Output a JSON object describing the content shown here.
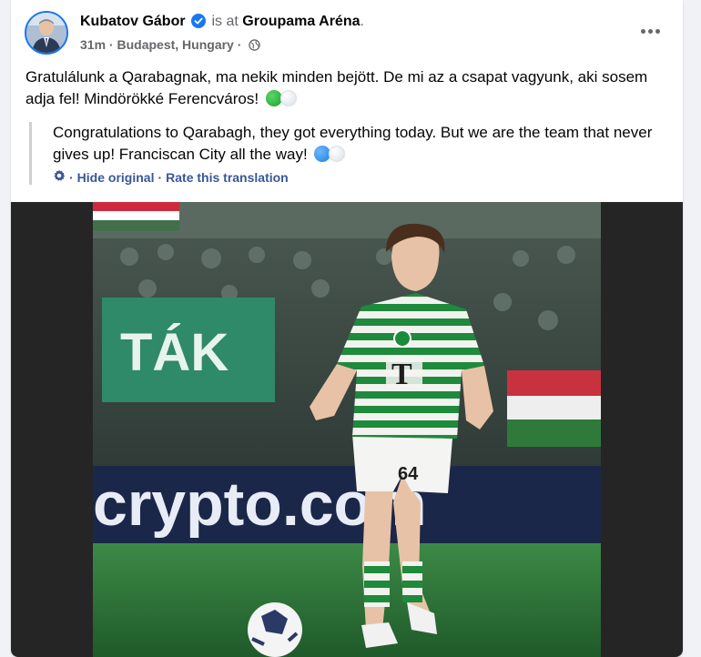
{
  "post": {
    "author_name": "Kubatov Gábor",
    "is_at": "is at",
    "place": "Groupama Aréna",
    "period": ".",
    "time": "31m",
    "location": "Budapest, Hungary",
    "separator": "·",
    "original_text": "Gratulálunk a Qarabagnak, ma nekik minden bejött. De mi az a csapat vagyunk, aki sosem adja fel! Mindörökké Ferencváros!",
    "translation_text": "Congratulations to Qarabagh, they got everything today. But we are the team that never gives up! Franciscan City all the way!",
    "hide_original": "Hide original",
    "rate_translation": "Rate this translation",
    "dot": "·"
  },
  "photo": {
    "banner_text_left": "TÁK",
    "banner_text_ad": "crypto.com",
    "shirt_number": "64",
    "shirt_logo": "T"
  },
  "icons": {
    "verified": "verified-badge-icon",
    "globe": "globe-icon",
    "more": "more-options-icon",
    "settings": "gear-icon"
  },
  "colors": {
    "accent": "#1877f2",
    "link": "#385898",
    "pitch": "#2f7a3a",
    "kit_green": "#1e8a3c"
  }
}
